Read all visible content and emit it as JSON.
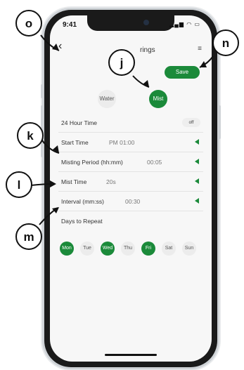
{
  "status_bar": {
    "time": "9:41",
    "icons": "signal wifi battery"
  },
  "header": {
    "title": "rings",
    "save_label": "Save"
  },
  "mode": {
    "water_label": "Water",
    "mist_label": "Mist",
    "selected": "Mist"
  },
  "settings": {
    "hour24": {
      "label": "24 Hour Time",
      "value": "off"
    },
    "start_time": {
      "label": "Start Time",
      "value": "PM 01:00"
    },
    "misting_period": {
      "label": "Misting Period (hh:mm)",
      "value": "00:05"
    },
    "mist_time": {
      "label": "Mist Time",
      "value": "20s"
    },
    "interval": {
      "label": "Interval (mm:ss)",
      "value": "00:30"
    },
    "days_label": "Days to Repeat"
  },
  "days": [
    {
      "label": "Mon",
      "selected": true
    },
    {
      "label": "Tue",
      "selected": false
    },
    {
      "label": "Wed",
      "selected": true
    },
    {
      "label": "Thu",
      "selected": false
    },
    {
      "label": "Fri",
      "selected": true
    },
    {
      "label": "Sat",
      "selected": false
    },
    {
      "label": "Sun",
      "selected": false
    }
  ],
  "callouts": {
    "o": "o",
    "n": "n",
    "j": "j",
    "k": "k",
    "l": "l",
    "m": "m"
  },
  "colors": {
    "accent": "#1b8a3a",
    "background": "#f7f7f7"
  }
}
